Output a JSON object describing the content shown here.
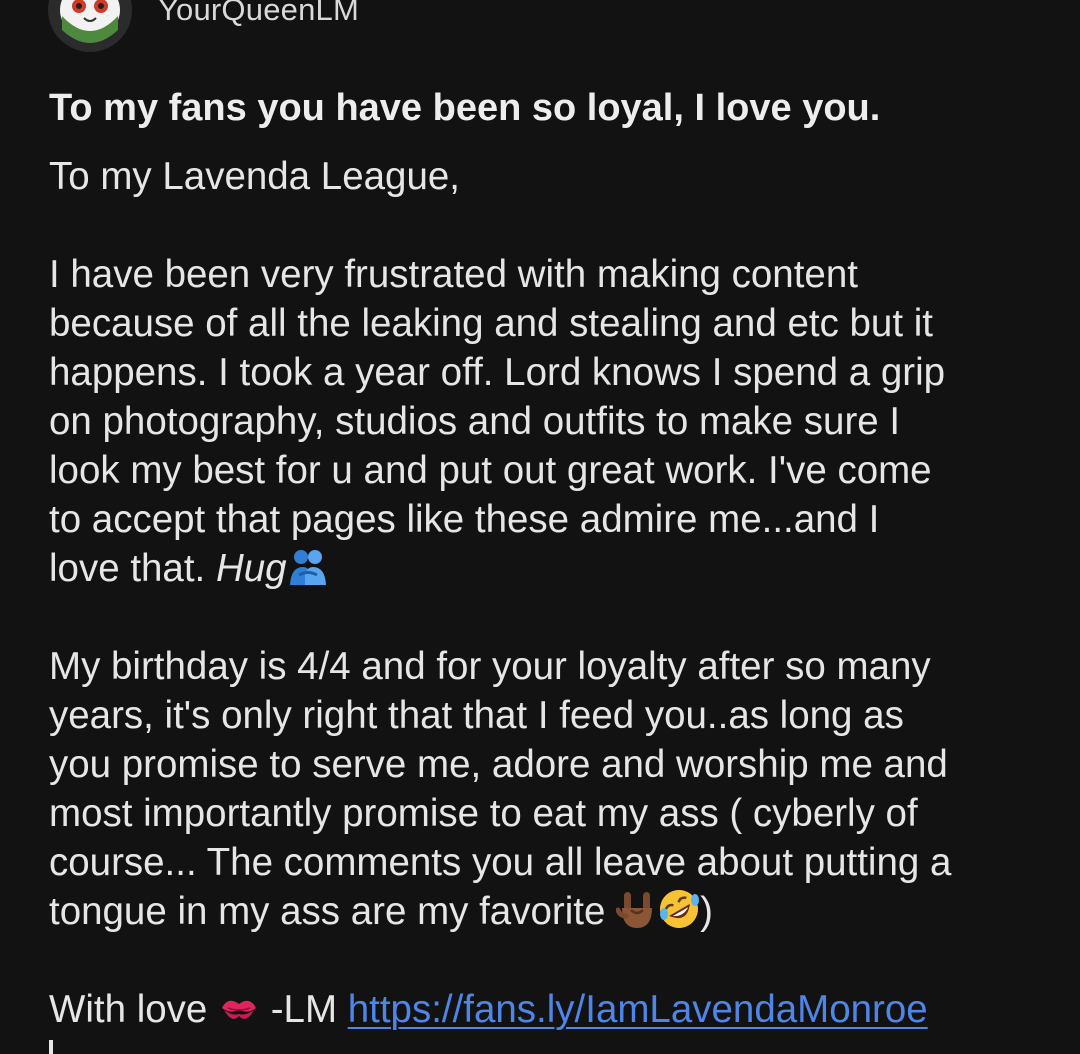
{
  "post": {
    "author": {
      "username": "YourQueenLM",
      "avatar_icon": "cat-avatar-icon"
    },
    "title": "To my fans you have been so loyal, I love you.",
    "salutation": "To my Lavenda League,",
    "paragraph1": {
      "lines": [
        "I have been very frustrated with making content",
        "because of all the leaking and stealing and etc but it",
        "happens. I took a year off. Lord knows I spend a grip",
        "on photography, studios and outfits to make sure I",
        "look my best for u and put out great work. I've come",
        "to accept that pages like these admire me...and I"
      ],
      "last_line_text": "love that. ",
      "last_line_italic": "Hug",
      "last_line_emoji": "people-hugging-icon"
    },
    "paragraph2": {
      "lines": [
        "My birthday is 4/4 and for your loyalty after so many",
        "years, it's only right that that I feed you..as long as",
        "you promise to serve me, adore and worship me and",
        "most importantly promise to eat my ass ( cyberly of",
        "course... The comments you all leave about putting a"
      ],
      "last_line_text": "tongue in my ass are my favorite ",
      "last_line_emojis": [
        "rock-on-hand-icon",
        "rolling-laughing-face-icon"
      ],
      "last_line_close": ")"
    },
    "signoff": {
      "text_before": "With love ",
      "emoji": "kiss-mark-icon",
      "text_after": " -LM ",
      "link": "https://fans.ly/IamLavendaMonroe"
    },
    "colors": {
      "background": "#121212",
      "text": "#e6e6e6",
      "link": "#4e86e8"
    }
  }
}
